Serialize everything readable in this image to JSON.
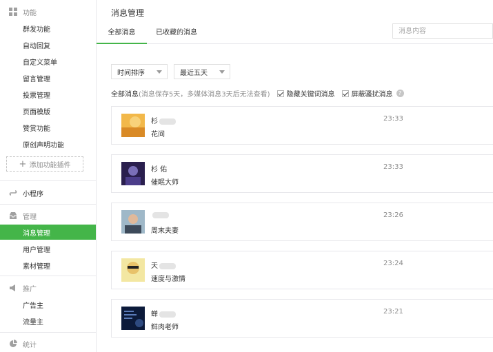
{
  "sidebar": {
    "features": {
      "title": "功能",
      "items": [
        "群发功能",
        "自动回复",
        "自定义菜单",
        "留言管理",
        "投票管理",
        "页面模版",
        "赞赏功能",
        "原创声明功能"
      ],
      "add_plugin": "添加功能插件"
    },
    "miniprogram": {
      "title": "小程序"
    },
    "management": {
      "title": "管理",
      "items": [
        "消息管理",
        "用户管理",
        "素材管理"
      ],
      "active": "消息管理"
    },
    "promotion": {
      "title": "推广",
      "items": [
        "广告主",
        "流量主"
      ]
    },
    "stats": {
      "title": "统计"
    }
  },
  "main": {
    "title": "消息管理",
    "tabs": [
      {
        "label": "全部消息",
        "active": true
      },
      {
        "label": "已收藏的消息",
        "active": false
      }
    ],
    "search": {
      "placeholder": "消息内容"
    },
    "sort_select": "时间排序",
    "range_select": "最近五天",
    "filter": {
      "label": "全部消息",
      "note": "(消息保存5天，多媒体消息3天后无法查看)",
      "hide_keyword": "隐藏关键词消息",
      "block_spam": "屏蔽骚扰消息",
      "help": "?"
    },
    "messages": [
      {
        "name": "杉",
        "text": "花间",
        "time": "23:33"
      },
      {
        "name": "杉    佑",
        "text": "催眠大师",
        "time": "23:33"
      },
      {
        "name": "",
        "text": "周末夫妻",
        "time": "23:26"
      },
      {
        "name": "天",
        "text": "速度与激情",
        "time": "23:24"
      },
      {
        "name": "蝉",
        "text": "鲜肉老师",
        "time": "23:21"
      }
    ]
  },
  "colors": {
    "accent": "#44b549",
    "border": "#e7e7eb",
    "muted": "#8d8d8d"
  }
}
